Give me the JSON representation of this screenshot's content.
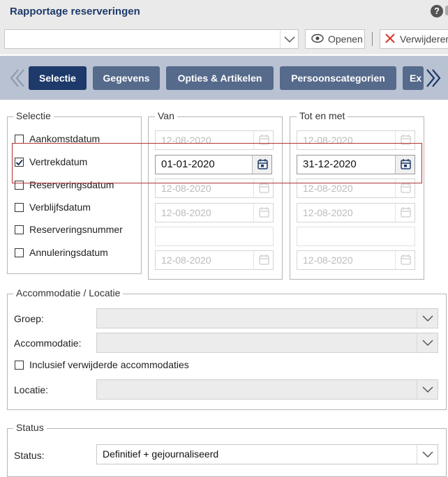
{
  "window": {
    "title": "Rapportage reserveringen",
    "help_icon": "?"
  },
  "toolbar": {
    "report_select_value": "",
    "open_label": "Openen",
    "delete_label": "Verwijderen"
  },
  "tabs": [
    {
      "label": "Selectie",
      "active": true
    },
    {
      "label": "Gegevens",
      "active": false
    },
    {
      "label": "Opties & Artikelen",
      "active": false
    },
    {
      "label": "Persoonscategorien",
      "active": false
    },
    {
      "label": "Ex",
      "active": false
    }
  ],
  "selectie": {
    "legend": "Selectie",
    "items": [
      {
        "label": "Aankomstdatum",
        "checked": false
      },
      {
        "label": "Vertrekdatum",
        "checked": true
      },
      {
        "label": "Reserveringsdatum",
        "checked": false
      },
      {
        "label": "Verblijfsdatum",
        "checked": false
      },
      {
        "label": "Reserveringsnummer",
        "checked": false
      },
      {
        "label": "Annuleringsdatum",
        "checked": false
      }
    ]
  },
  "van": {
    "legend": "Van",
    "values": [
      "12-08-2020",
      "01-01-2020",
      "12-08-2020",
      "12-08-2020",
      "",
      "12-08-2020"
    ]
  },
  "tot": {
    "legend": "Tot en met",
    "values": [
      "12-08-2020",
      "31-12-2020",
      "12-08-2020",
      "12-08-2020",
      "",
      "12-08-2020"
    ]
  },
  "accommodatie": {
    "legend": "Accommodatie / Locatie",
    "groep_label": "Groep:",
    "groep_value": "",
    "accommodatie_label": "Accommodatie:",
    "accommodatie_value": "",
    "inclusief_label": "Inclusief verwijderde accommodaties",
    "inclusief_checked": false,
    "locatie_label": "Locatie:",
    "locatie_value": ""
  },
  "status": {
    "legend": "Status",
    "status_label": "Status:",
    "status_value": "Definitief + gejournaliseerd"
  },
  "colors": {
    "accent": "#1e3a6a",
    "tab": "#566a8b",
    "tabstrip": "#b9c2d2",
    "highlight": "#b03434",
    "delete_x": "#d9362b"
  }
}
